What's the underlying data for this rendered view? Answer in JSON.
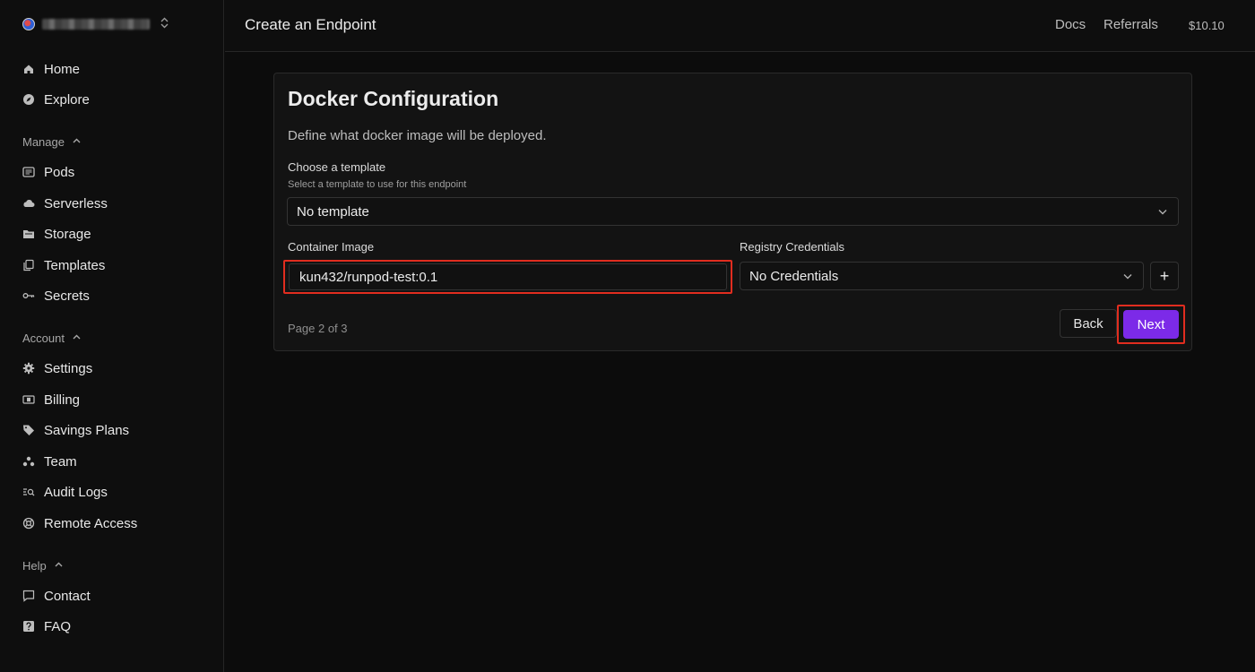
{
  "sidebar": {
    "org_name": "",
    "items_top": [
      {
        "label": "Home",
        "icon": "home-icon"
      },
      {
        "label": "Explore",
        "icon": "compass-icon"
      }
    ],
    "manage": {
      "label": "Manage",
      "items": [
        {
          "label": "Pods",
          "icon": "pods-icon"
        },
        {
          "label": "Serverless",
          "icon": "cloud-icon"
        },
        {
          "label": "Storage",
          "icon": "folder-icon"
        },
        {
          "label": "Templates",
          "icon": "copy-icon"
        },
        {
          "label": "Secrets",
          "icon": "key-icon"
        }
      ]
    },
    "account": {
      "label": "Account",
      "items": [
        {
          "label": "Settings",
          "icon": "gear-icon"
        },
        {
          "label": "Billing",
          "icon": "billing-icon"
        },
        {
          "label": "Savings Plans",
          "icon": "tag-icon"
        },
        {
          "label": "Team",
          "icon": "team-icon"
        },
        {
          "label": "Audit Logs",
          "icon": "audit-icon"
        },
        {
          "label": "Remote Access",
          "icon": "lifebuoy-icon"
        }
      ]
    },
    "help": {
      "label": "Help",
      "items": [
        {
          "label": "Contact",
          "icon": "chat-icon"
        },
        {
          "label": "FAQ",
          "icon": "question-icon"
        }
      ]
    }
  },
  "topbar": {
    "title": "Create an Endpoint",
    "docs": "Docs",
    "referrals": "Referrals",
    "balance": "$10.10"
  },
  "card": {
    "title": "Docker Configuration",
    "description": "Define what docker image will be deployed.",
    "template": {
      "label": "Choose a template",
      "sublabel": "Select a template to use for this endpoint",
      "value": "No template"
    },
    "container_image": {
      "label": "Container Image",
      "value": "kun432/runpod-test:0.1"
    },
    "registry": {
      "label": "Registry Credentials",
      "value": "No Credentials",
      "add_label": "+"
    },
    "page_indicator": "Page 2 of 3",
    "back_label": "Back",
    "next_label": "Next"
  },
  "colors": {
    "accent": "#7c2ae8",
    "highlight": "#e12d1f",
    "background": "#0c0c0c"
  }
}
